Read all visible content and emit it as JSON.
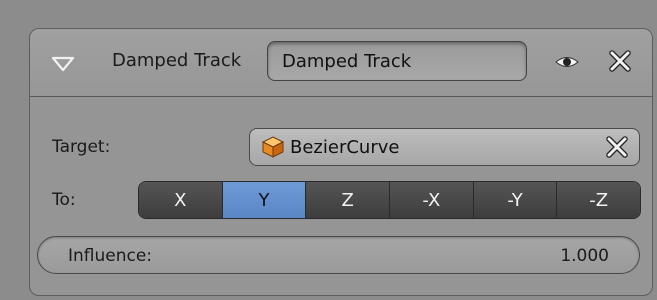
{
  "constraint": {
    "type_label": "Damped Track",
    "name_value": "Damped Track"
  },
  "target": {
    "label": "Target:",
    "value": "BezierCurve"
  },
  "to": {
    "label": "To:",
    "axes": [
      "X",
      "Y",
      "Z",
      "-X",
      "-Y",
      "-Z"
    ],
    "selected": "Y"
  },
  "influence": {
    "label": "Influence:",
    "value": "1.000"
  },
  "colors": {
    "panel_bg": "#959595",
    "axis_button": "#4a4a4a",
    "axis_active": "#6690d0"
  },
  "icons": {
    "collapse": "disclosure-triangle-down-icon",
    "visibility": "eye-icon",
    "delete": "close-x-icon",
    "object": "object-cube-icon"
  }
}
